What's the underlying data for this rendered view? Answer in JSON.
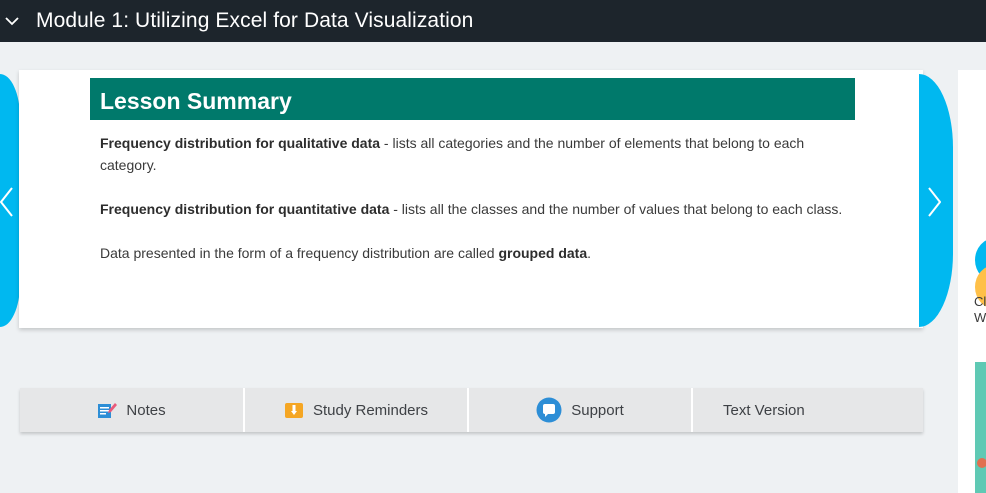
{
  "header": {
    "title": "Module 1: Utilizing Excel for Data Visualization",
    "collapse_icon": "chevron-down-icon"
  },
  "lesson": {
    "heading": "Lesson Summary",
    "para1": {
      "bold": "Frequency distribution for qualitative data",
      "text": " - lists all categories and the number of elements that belong to each category."
    },
    "para2": {
      "bold": "Frequency distribution for quantitative data",
      "text": " - lists all the classes and the number of values that belong to each class."
    },
    "para3": {
      "text_before": "Data presented in the form of a frequency distribution are called ",
      "bold": "grouped data",
      "text_after": "."
    }
  },
  "navigation": {
    "prev_icon": "chevron-left-icon",
    "next_icon": "chevron-right-icon"
  },
  "side_peek": {
    "text_line1": "Cl",
    "text_line2": "W"
  },
  "toolbar": {
    "notes_label": "Notes",
    "reminders_label": "Study Reminders",
    "support_label": "Support",
    "text_version_label": "Text Version"
  },
  "colors": {
    "topbar": "#1d252c",
    "banner": "#00796b",
    "nav_arrow": "#00b8f0",
    "toolbar_bg": "#e6e7e8"
  }
}
